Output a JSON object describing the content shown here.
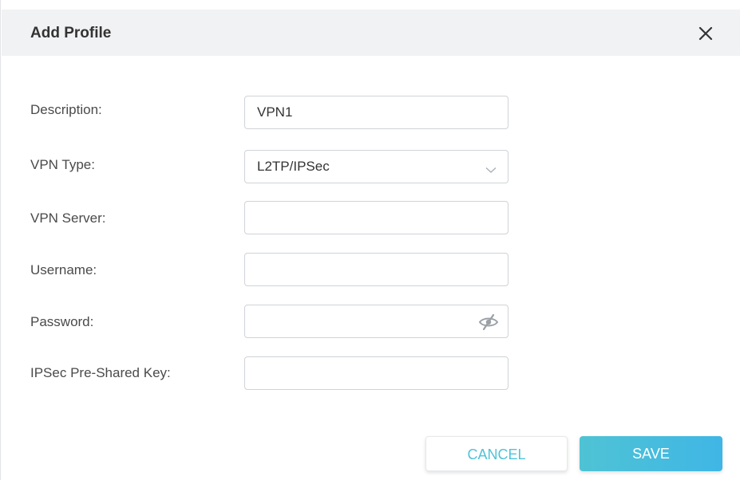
{
  "dialog": {
    "title": "Add Profile",
    "close_icon": "close-icon"
  },
  "form": {
    "description": {
      "label": "Description:",
      "value": "VPN1"
    },
    "vpn_type": {
      "label": "VPN Type:",
      "selected": "L2TP/IPSec",
      "icon": "chevron-down-icon"
    },
    "vpn_server": {
      "label": "VPN Server:",
      "value": ""
    },
    "username": {
      "label": "Username:",
      "value": ""
    },
    "password": {
      "label": "Password:",
      "value": "",
      "icon": "eye-off-icon"
    },
    "psk": {
      "label": "IPSec Pre-Shared Key:",
      "value": ""
    }
  },
  "buttons": {
    "cancel": "CANCEL",
    "save": "SAVE"
  },
  "colors": {
    "accent": "#4fc3d8",
    "header_bg": "#f1f2f4",
    "border": "#cfd3d8"
  }
}
